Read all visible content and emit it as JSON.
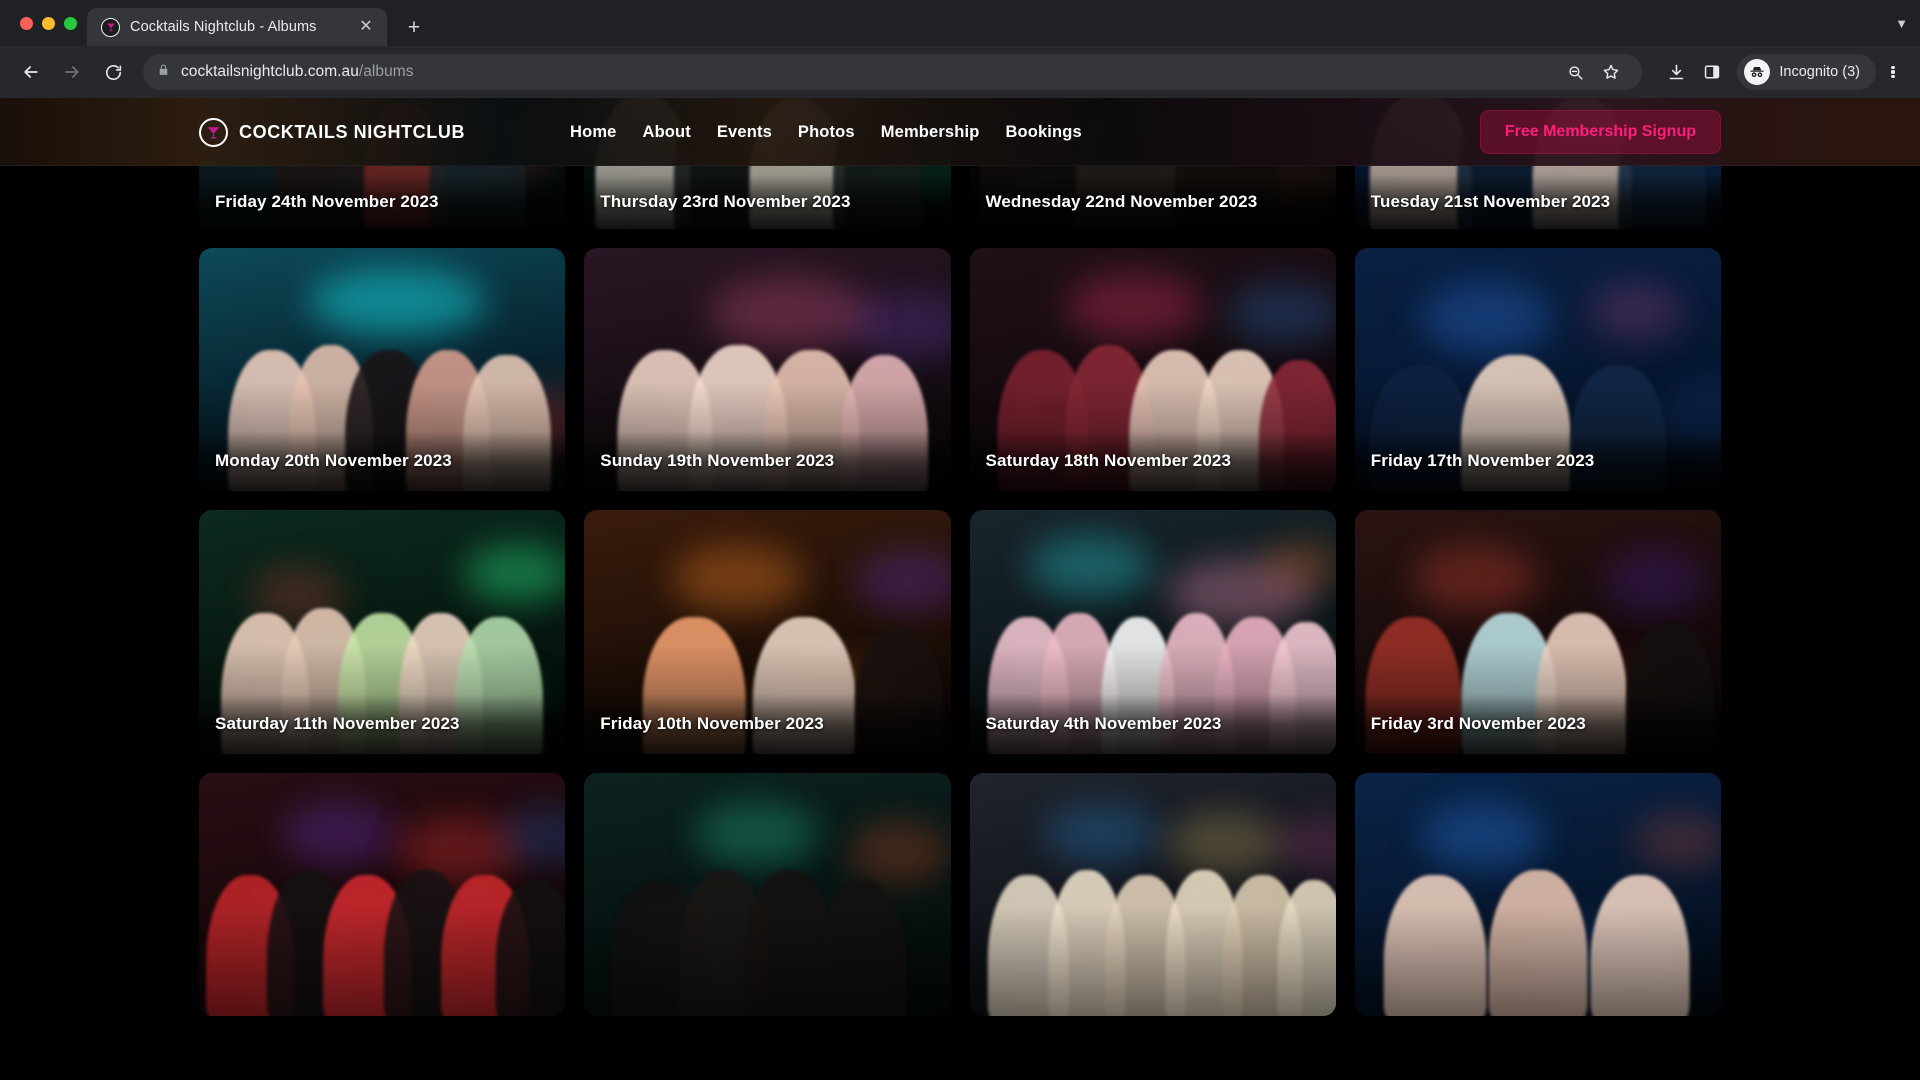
{
  "browser": {
    "tab": {
      "title": "Cocktails Nightclub - Albums",
      "favicon_icon": "cocktail-glass-icon",
      "close_icon": "close-icon"
    },
    "new_tab_icon": "plus-icon",
    "tab_list_icon": "chevron-down-icon",
    "nav": {
      "back_icon": "back-arrow-icon",
      "forward_icon": "forward-arrow-icon",
      "reload_icon": "reload-icon"
    },
    "omnibox": {
      "lock_icon": "lock-icon",
      "url_host": "cocktailsnightclub.com.au",
      "url_path": "/albums",
      "zoom_out_icon": "zoom-out-icon",
      "bookmark_icon": "star-icon"
    },
    "toolbar_right": {
      "download_icon": "download-icon",
      "side_panel_icon": "side-panel-icon",
      "profile_icon": "incognito-icon",
      "profile_label": "Incognito (3)",
      "menu_icon": "kebab-menu-icon"
    }
  },
  "site": {
    "brand": {
      "logo_icon": "cocktail-glass-logo-icon",
      "name": "COCKTAILS NIGHTCLUB",
      "accent_color": "#c21b8d"
    },
    "nav_links": [
      {
        "label": "Home"
      },
      {
        "label": "About"
      },
      {
        "label": "Events"
      },
      {
        "label": "Photos"
      },
      {
        "label": "Membership"
      },
      {
        "label": "Bookings"
      }
    ],
    "cta": {
      "label": "Free Membership Signup",
      "text_color": "#ff1f7a",
      "background_color": "#5e0a26"
    }
  },
  "albums": [
    {
      "caption": "Friday 24th November 2023",
      "theme": "teal-crowd"
    },
    {
      "caption": "Thursday 23rd November 2023",
      "theme": "green-crowd"
    },
    {
      "caption": "Wednesday 22nd November 2023",
      "theme": "dj-booth"
    },
    {
      "caption": "Tuesday 21st November 2023",
      "theme": "blue-crowd"
    },
    {
      "caption": "Monday 20th November 2023",
      "theme": "cyan-group"
    },
    {
      "caption": "Sunday 19th November 2023",
      "theme": "pink-group"
    },
    {
      "caption": "Saturday 18th November 2023",
      "theme": "maroon-group"
    },
    {
      "caption": "Friday 17th November 2023",
      "theme": "blue-solo"
    },
    {
      "caption": "Saturday 11th November 2023",
      "theme": "neon-green-group"
    },
    {
      "caption": "Friday 10th November 2023",
      "theme": "orange-bar"
    },
    {
      "caption": "Saturday 4th November 2023",
      "theme": "pink-hens"
    },
    {
      "caption": "Friday 3rd November 2023",
      "theme": "red-lounge"
    },
    {
      "caption": "",
      "theme": "red-costume"
    },
    {
      "caption": "",
      "theme": "dark-cops"
    },
    {
      "caption": "",
      "theme": "cowboy-hats"
    },
    {
      "caption": "",
      "theme": "blue-trio"
    }
  ]
}
